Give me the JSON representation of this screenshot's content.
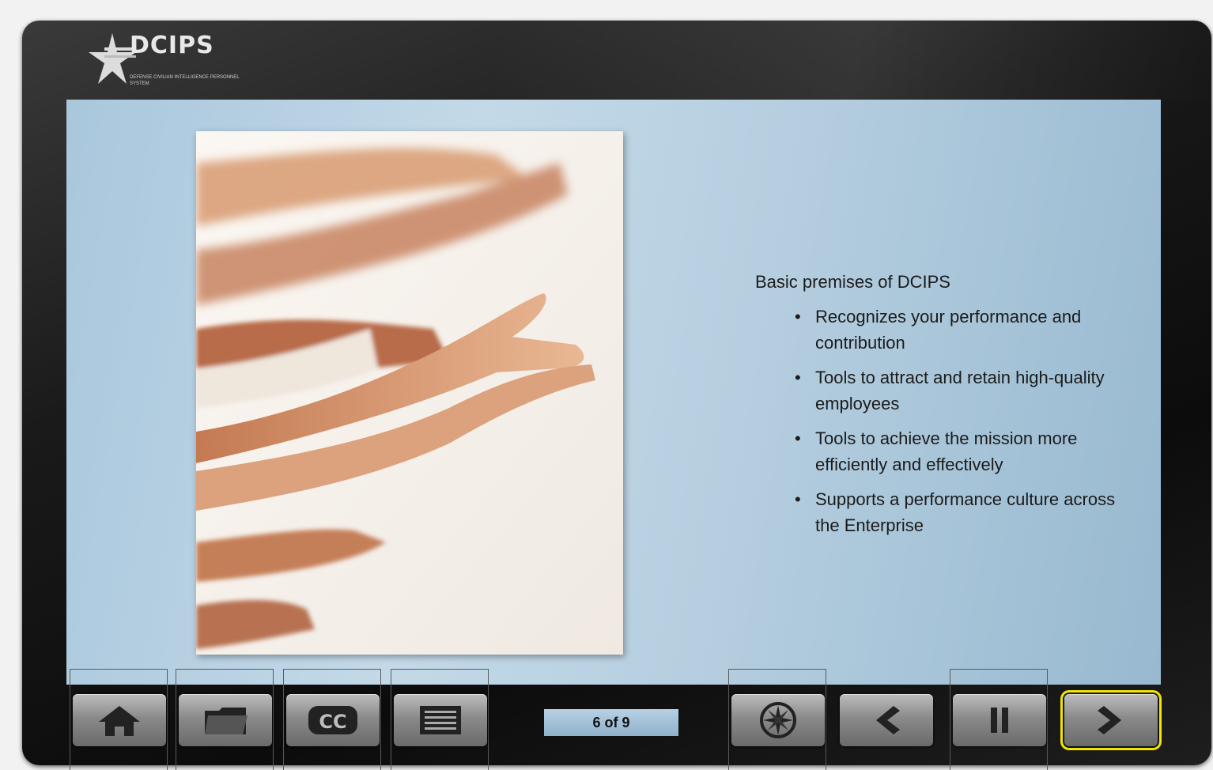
{
  "logo": {
    "title": "DCIPS",
    "subtitle": "DEFENSE CIVILIAN INTELLIGENCE PERSONNEL SYSTEM"
  },
  "slide": {
    "heading": "Basic premises of DCIPS",
    "bullets": [
      "Recognizes your performance and contribution",
      "Tools to attract and retain high-quality employees",
      "Tools to achieve the mission more efficiently and effectively",
      "Supports a performance culture across the Enterprise"
    ]
  },
  "toolbar": {
    "page_counter": "6 of 9",
    "buttons": [
      {
        "name": "home",
        "icon": "home-icon"
      },
      {
        "name": "resources",
        "icon": "folder-icon"
      },
      {
        "name": "closed-captions",
        "icon": "cc-icon"
      },
      {
        "name": "menu",
        "icon": "list-icon"
      },
      {
        "name": "navigation",
        "icon": "compass-icon"
      },
      {
        "name": "previous",
        "icon": "chevron-left-icon"
      },
      {
        "name": "pause",
        "icon": "pause-icon"
      },
      {
        "name": "next",
        "icon": "chevron-right-icon"
      }
    ]
  },
  "colors": {
    "slide_bg": "#b6cfe0",
    "highlight": "#f2e600",
    "frame": "#111111"
  }
}
